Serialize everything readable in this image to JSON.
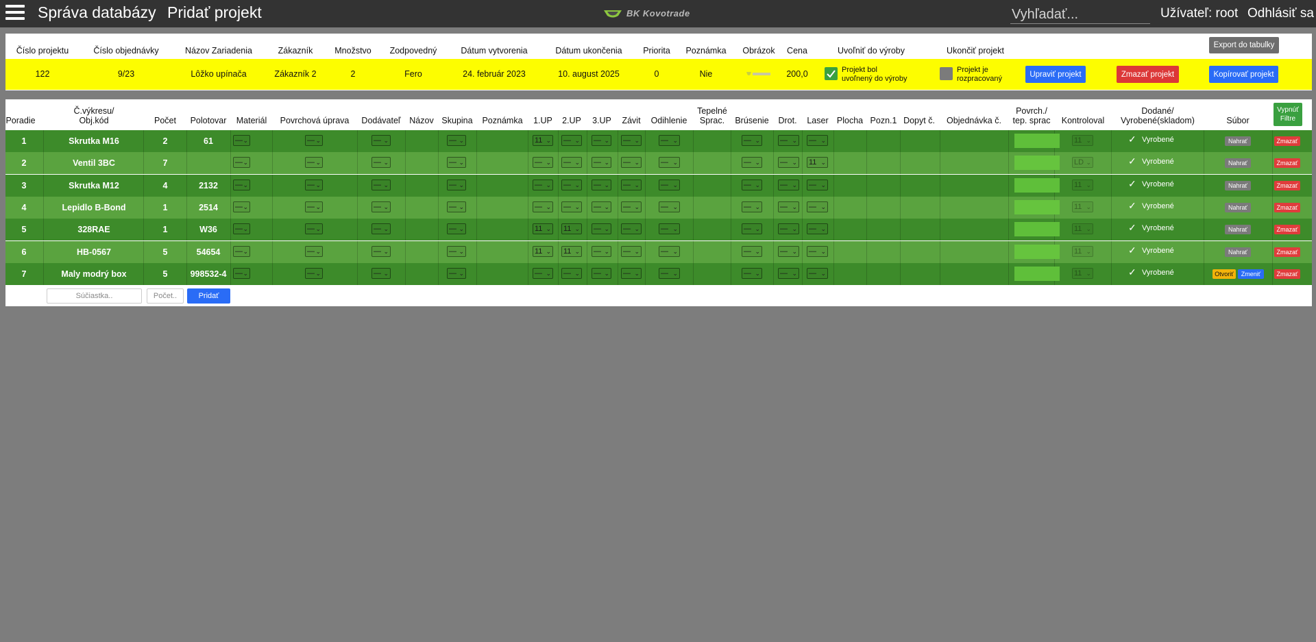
{
  "nav": {
    "title": "Správa databázy",
    "add_project": "Pridať projekt",
    "logo_text": "BK Kovotrade",
    "search_placeholder": "Vyhľadať...",
    "user_label": "Užívateľ: root",
    "logout": "Odhlásiť sa"
  },
  "project": {
    "export_label": "Export do tabulky",
    "headers": [
      "Číslo projektu",
      "Číslo objednávky",
      "Názov Zariadenia",
      "Zákazník",
      "Množstvo",
      "Zodpovedný",
      "Dátum vytvorenia",
      "Dátum ukončenia",
      "Priorita",
      "Poznámka",
      "Obrázok",
      "Cena",
      "Uvoľniť do výroby",
      "Ukončiť projekt"
    ],
    "values": {
      "cislo_projektu": "122",
      "cislo_objednavky": "9/23",
      "nazov": "Lôžko upínača",
      "zakaznik": "Zákazník 2",
      "mnozstvo": "2",
      "zodpovedny": "Fero",
      "datum_vytvorenia": "24. február 2023",
      "datum_ukoncenia": "10. august 2025",
      "priorita": "0",
      "poznamka": "Nie",
      "cena": "200,0"
    },
    "released_label_1": "Projekt bol",
    "released_label_2": "uvoľnený do výroby",
    "finished_label_1": "Projekt je",
    "finished_label_2": "rozpracovaný",
    "edit_label": "Upraviť projekt",
    "delete_label": "Zmazať projekt",
    "copy_label": "Kopírovať projekt",
    "colors": {
      "highlight": "#fdfd00",
      "blue": "#2a6cf6",
      "red": "#dc3838",
      "green": "#3aa040"
    }
  },
  "parts": {
    "headers": {
      "poradie": "Poradie",
      "vykres_1": "Č.výkresu/",
      "vykres_2": "Obj.kód",
      "pocet": "Počet",
      "polotovar": "Polotovar",
      "material": "Materiál",
      "povrchova": "Povrchová úprava",
      "dodavatel": "Dodávateľ",
      "nazov": "Názov",
      "skupina": "Skupina",
      "poznamka": "Poznámka",
      "up1": "1.UP",
      "up2": "2.UP",
      "up3": "3.UP",
      "zavit": "Závit",
      "odihlenie": "Odihlenie",
      "tepelne_1": "Tepelné",
      "tepelne_2": "Sprac.",
      "brusenie": "Brúsenie",
      "drot": "Drot.",
      "laser": "Laser",
      "plocha": "Plocha",
      "pozn1": "Pozn.1",
      "dopyt": "Dopyt č.",
      "objednavka": "Objednávka č.",
      "povrch_1": "Povrch./",
      "povrch_2": "tep. sprac",
      "kontroloval": "Kontroloval",
      "dodane_1": "Dodané/",
      "dodane_2": "Vyrobené(skladom)",
      "subor": "Súbor",
      "filter_1": "Vypnúť",
      "filter_2": "Filtre"
    },
    "select_empty": "—",
    "status_label": "Vyrobené",
    "upload_label": "Nahrať",
    "delete_label": "Zmazať",
    "open_label": "Otvoriť",
    "change_label": "Zmeniť",
    "rows": [
      {
        "poradie": "1",
        "nazov": "Skrutka M16",
        "pocet": "2",
        "polotovar": "61",
        "up1": "11",
        "up2": "—",
        "laser": "—",
        "kontroloval": "11"
      },
      {
        "poradie": "2",
        "nazov": "Ventil 3BC",
        "pocet": "7",
        "polotovar": "",
        "up1": "—",
        "up2": "—",
        "laser": "11",
        "kontroloval": "LD"
      },
      {
        "poradie": "3",
        "nazov": "Skrutka M12",
        "pocet": "4",
        "polotovar": "2132",
        "up1": "—",
        "up2": "—",
        "laser": "—",
        "kontroloval": "11"
      },
      {
        "poradie": "4",
        "nazov": "Lepidlo B-Bond",
        "pocet": "1",
        "polotovar": "2514",
        "up1": "—",
        "up2": "—",
        "laser": "—",
        "kontroloval": "11"
      },
      {
        "poradie": "5",
        "nazov": "328RAE",
        "pocet": "1",
        "polotovar": "W36",
        "up1": "11",
        "up2": "11",
        "laser": "—",
        "kontroloval": "11"
      },
      {
        "poradie": "6",
        "nazov": "HB-0567",
        "pocet": "5",
        "polotovar": "54654",
        "up1": "11",
        "up2": "11",
        "laser": "—",
        "kontroloval": "11"
      },
      {
        "poradie": "7",
        "nazov": "Maly modrý box",
        "pocet": "5",
        "polotovar": "998532-4",
        "up1": "—",
        "up2": "—",
        "laser": "—",
        "kontroloval": "11"
      }
    ],
    "add": {
      "part_placeholder": "Súčiastka..",
      "count_placeholder": "Počet..",
      "add_label": "Pridať"
    },
    "colors": {
      "row_dark": "#3d8b2a",
      "row_light": "#5aa33f"
    }
  }
}
